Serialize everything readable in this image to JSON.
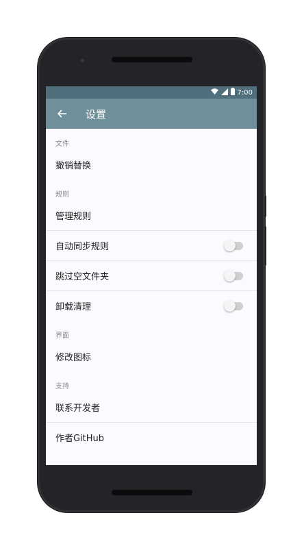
{
  "status_bar": {
    "time": "7:00",
    "wifi_icon": "wifi-icon",
    "signal_icon": "signal-icon",
    "battery_icon": "battery-icon"
  },
  "toolbar": {
    "title": "设置"
  },
  "sections": [
    {
      "header": "文件",
      "items": [
        {
          "label": "撤销替换"
        }
      ]
    },
    {
      "header": "规则",
      "items": [
        {
          "label": "管理规则"
        },
        {
          "label": "自动同步规则",
          "toggle": false
        },
        {
          "label": "跳过空文件夹",
          "toggle": false
        },
        {
          "label": "卸载清理",
          "toggle": false
        }
      ]
    },
    {
      "header": "界面",
      "items": [
        {
          "label": "修改图标"
        }
      ]
    },
    {
      "header": "支持",
      "items": [
        {
          "label": "联系开发者"
        },
        {
          "label": "作者GitHub"
        }
      ]
    }
  ],
  "colors": {
    "toolbar": "#6f8f9a",
    "status_bar": "#4f6f7c",
    "background": "#fbfafe"
  }
}
